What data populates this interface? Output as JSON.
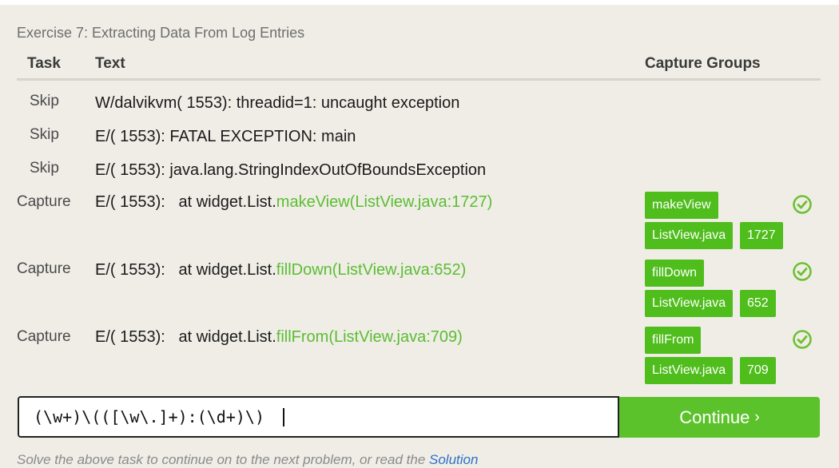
{
  "exercise": {
    "title": "Exercise 7: Extracting Data From Log Entries"
  },
  "table": {
    "headers": {
      "task": "Task",
      "text": "Text",
      "groups": "Capture Groups"
    },
    "rows": [
      {
        "task": "Skip",
        "text": "W/dalvikvm( 1553): threadid=1: uncaught exception"
      },
      {
        "task": "Skip",
        "text": "E/( 1553): FATAL EXCEPTION: main"
      },
      {
        "task": "Skip",
        "text": "E/( 1553): java.lang.StringIndexOutOfBoundsException"
      },
      {
        "task": "Capture",
        "prefix": "E/( 1553):   at widget.List.",
        "match": "makeView(ListView.java:1727)",
        "groups": [
          "makeView",
          "ListView.java",
          "1727"
        ],
        "status": "matched"
      },
      {
        "task": "Capture",
        "prefix": "E/( 1553):   at widget.List.",
        "match": "fillDown(ListView.java:652)",
        "groups": [
          "fillDown",
          "ListView.java",
          "652"
        ],
        "status": "matched"
      },
      {
        "task": "Capture",
        "prefix": "E/( 1553):   at widget.List.",
        "match": "fillFrom(ListView.java:709)",
        "groups": [
          "fillFrom",
          "ListView.java",
          "709"
        ],
        "status": "matched"
      }
    ]
  },
  "regex_input": {
    "value": "(\\w+)\\(([\\w\\.]+):(\\d+)\\)"
  },
  "continue_button": {
    "label": "Continue",
    "icon": "chevron-right-icon"
  },
  "footer": {
    "text": "Solve the above task to continue on to the next problem, or read the ",
    "link": "Solution"
  },
  "colors": {
    "match": "#5cbd33",
    "chip": "#4fbd1c",
    "button": "#5cc22b",
    "check": "#6cbf2f"
  }
}
